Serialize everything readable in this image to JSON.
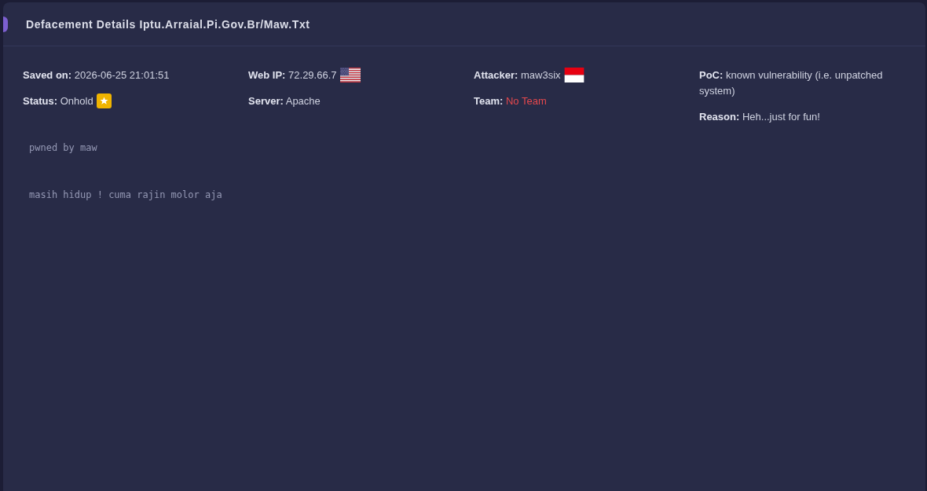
{
  "card": {
    "title": "Defacement Details Iptu.Arraial.Pi.Gov.Br/Maw.Txt"
  },
  "columns": [
    {
      "fields": [
        {
          "kind": "text",
          "label": "Saved on:",
          "value": "2026-06-25 21:01:51"
        },
        {
          "kind": "badge",
          "label": "Status:",
          "value": "Onhold"
        }
      ]
    },
    {
      "fields": [
        {
          "kind": "usflag",
          "label": "Web IP:",
          "value": "72.29.66.7"
        },
        {
          "kind": "text",
          "label": "Server:",
          "value": "Apache"
        }
      ]
    },
    {
      "fields": [
        {
          "kind": "idflag",
          "label": "Attacker:",
          "value": "maw3six"
        },
        {
          "kind": "warning",
          "label": "Team:",
          "value": "No Team"
        }
      ]
    },
    {
      "fields": [
        {
          "kind": "text",
          "label": "PoC:",
          "value": "known vulnerability (i.e. unpatched system)"
        },
        {
          "kind": "text",
          "label": "Reason:",
          "value": "Heh...just for fun!"
        }
      ]
    }
  ],
  "message": [
    "pwned by maw",
    "masih hidup ! cuma rajin molor aja"
  ]
}
